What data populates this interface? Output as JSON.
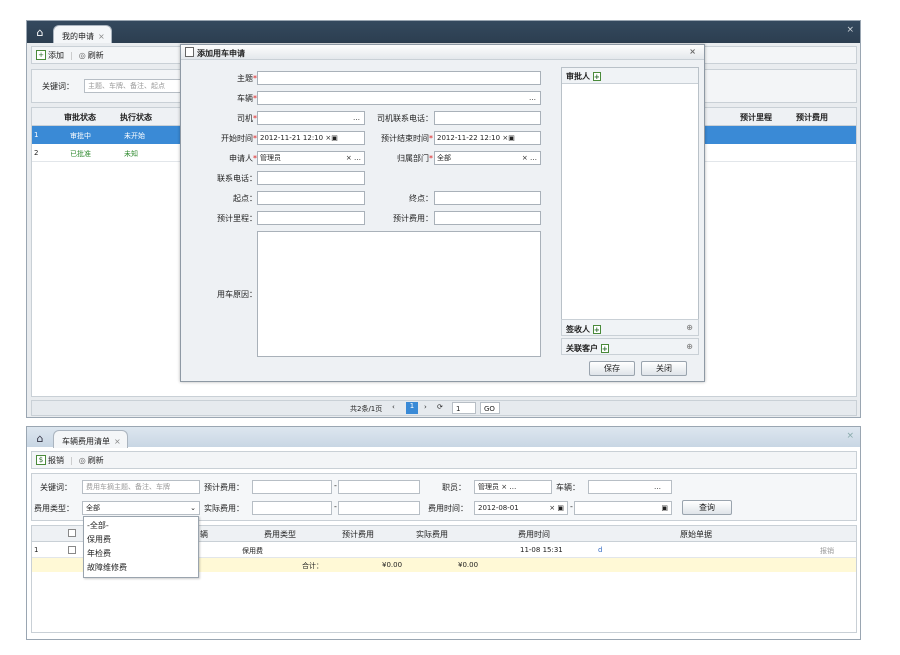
{
  "panel1": {
    "tab_label": "我的申请",
    "toolbar": {
      "add": "添加",
      "refresh": "刷新"
    },
    "search": {
      "keyword_label": "关键词：",
      "keyword_placeholder": "主题、车牌、备注、起点"
    },
    "columns": [
      "审批状态",
      "执行状态",
      "预计里程",
      "预计费用"
    ],
    "rows": [
      {
        "num": "1",
        "approval": "审批中",
        "exec": "未开始"
      },
      {
        "num": "2",
        "approval": "已批准",
        "exec": "未知"
      }
    ],
    "pager": "共2条/1页"
  },
  "dialog": {
    "title": "添加用车申请",
    "fields": {
      "subject": "主题",
      "plate": "车辆",
      "driver": "司机",
      "driver_phone": "司机联系电话：",
      "start_time": "开始时间",
      "start_value": "2012-11-21 12:10",
      "end_time": "预计结束时间",
      "end_value": "2012-11-22 12:10",
      "applicant": "申请人",
      "applicant_value": "管理员",
      "dept": "归属部门",
      "dept_value": "全部",
      "phone": "联系电话：",
      "start_point": "起点：",
      "end_point": "终点：",
      "est_distance": "预计里程：",
      "est_cost": "预计费用：",
      "reason": "用车原因："
    },
    "right": {
      "approver": "审批人",
      "receiver": "签收人",
      "customer": "关联客户"
    },
    "buttons": {
      "save": "保存",
      "close": "关闭"
    }
  },
  "panel2": {
    "tab_label": "车辆费用清单",
    "toolbar": {
      "reimburse": "报销",
      "refresh": "刷新"
    },
    "search": {
      "keyword_label": "关键词：",
      "keyword_placeholder": "费用车摘主题、备注、车牌",
      "est_cost_label": "预计费用：",
      "staff_label": "职员：",
      "staff_value": "管理员",
      "vehicle_label": "车辆：",
      "fee_type_label": "费用类型：",
      "fee_type_value": "全部",
      "actual_cost_label": "实际费用：",
      "fee_time_label": "费用时间：",
      "fee_time_value": "2012-08-01",
      "query": "查询"
    },
    "dropdown": [
      "-全部-",
      "保用费",
      "年检费",
      "故障维修费"
    ],
    "columns": [
      "辆",
      "费用类型",
      "预计费用",
      "实际费用",
      "费用时间",
      "原始单据"
    ],
    "row": {
      "num": "1",
      "type": "保用费",
      "time": "11-08 15:31",
      "doc": "d",
      "op": "报销"
    },
    "total": {
      "label": "合计：",
      "est": "¥0.00",
      "actual": "¥0.00"
    }
  },
  "colors": {
    "accent": "#2c3e50",
    "selected_row": "#3a8ad6",
    "approved": "#2f8a2f"
  }
}
